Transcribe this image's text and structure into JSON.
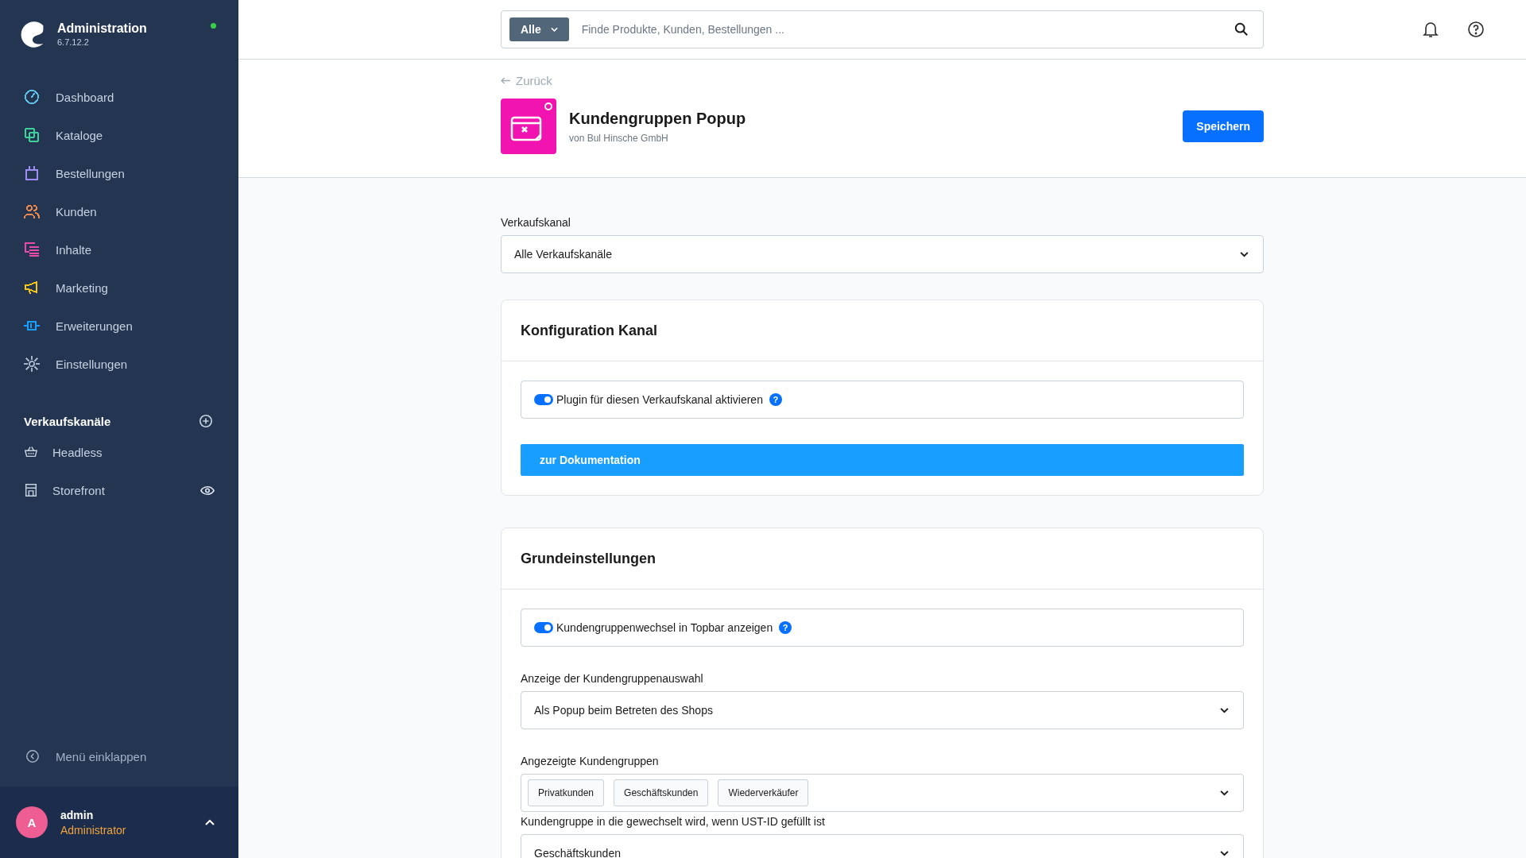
{
  "sidebar": {
    "title": "Administration",
    "version": "6.7.12.2",
    "online": true,
    "nav": [
      {
        "label": "Dashboard",
        "color": "#5ec1e8"
      },
      {
        "label": "Kataloge",
        "color": "#3fd19a"
      },
      {
        "label": "Bestellungen",
        "color": "#a08cf5"
      },
      {
        "label": "Kunden",
        "color": "#f08a4b"
      },
      {
        "label": "Inhalte",
        "color": "#ea4aaa"
      },
      {
        "label": "Marketing",
        "color": "#f5c518"
      },
      {
        "label": "Erweiterungen",
        "color": "#189eff"
      },
      {
        "label": "Einstellungen",
        "color": "#a3b1c6"
      }
    ],
    "sales_channels": {
      "heading": "Verkaufskanäle",
      "items": [
        {
          "label": "Headless",
          "kind": "basket",
          "preview": false
        },
        {
          "label": "Storefront",
          "kind": "store",
          "preview": true
        }
      ]
    },
    "collapse": "Menü einklappen",
    "user": {
      "initial": "A",
      "name": "admin",
      "role": "Administrator"
    }
  },
  "search": {
    "scope": "Alle",
    "placeholder": "Finde Produkte, Kunden, Bestellungen ..."
  },
  "page": {
    "back": "Zurück",
    "title": "Kundengruppen Popup",
    "vendor": "von Bul Hinsche GmbH",
    "save": "Speichern"
  },
  "channel": {
    "label": "Verkaufskanal",
    "value": "Alle Verkaufskanäle"
  },
  "cards": [
    {
      "title": "Konfiguration Kanal",
      "fields": [
        {
          "kind": "toggle",
          "label": "Plugin für diesen Verkaufskanal aktivieren",
          "on": true,
          "help": "?"
        },
        {
          "kind": "button",
          "label": "zur Dokumentation"
        }
      ]
    },
    {
      "title": "Grundeinstellungen",
      "fields": [
        {
          "kind": "toggle",
          "label": "Kundengruppenwechsel in Topbar anzeigen",
          "on": true,
          "help": "?"
        },
        {
          "kind": "select",
          "label": "Anzeige der Kundengruppenauswahl",
          "value": "Als Popup beim Betreten des Shops"
        },
        {
          "kind": "tags",
          "label": "Angezeigte Kundengruppen",
          "tags": [
            "Privatkunden",
            "Geschäftskunden",
            "Wiederverkäufer"
          ]
        },
        {
          "kind": "select",
          "label": "Kundengruppe in die gewechselt wird, wenn UST-ID gefüllt ist",
          "value": "Geschäftskunden"
        }
      ]
    }
  ]
}
